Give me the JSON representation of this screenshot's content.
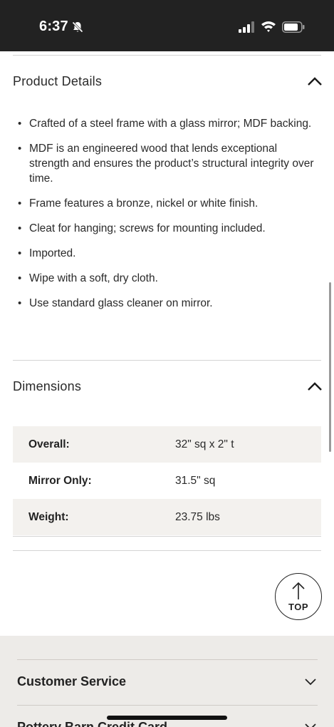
{
  "status_bar": {
    "time": "6:37",
    "icons": [
      "bell-slash-icon",
      "signal-icon",
      "wifi-icon",
      "battery-icon"
    ]
  },
  "product_details": {
    "title": "Product Details",
    "expanded": true,
    "bullets": [
      "Crafted of a steel frame with a glass mirror; MDF backing.",
      "MDF is an engineered wood that lends exceptional strength and ensures the product’s structural integrity over time.",
      "Frame features a bronze, nickel or white finish.",
      "Cleat for hanging; screws for mounting included.",
      "Imported.",
      "Wipe with a soft, dry cloth.",
      "Use standard glass cleaner on mirror."
    ]
  },
  "dimensions": {
    "title": "Dimensions",
    "expanded": true,
    "rows": [
      {
        "label": "Overall:",
        "value": "32\" sq x 2\" t"
      },
      {
        "label": "Mirror Only:",
        "value": "31.5\" sq"
      },
      {
        "label": "Weight:",
        "value": "23.75 lbs"
      }
    ]
  },
  "back_to_top": {
    "label": "TOP"
  },
  "footer": {
    "links": [
      "Customer Service",
      "Pottery Barn Credit Card"
    ]
  },
  "colors": {
    "status_bar_bg": "#222222",
    "shaded_row": "#f3f1ee",
    "footer_bg": "#edebe8"
  }
}
